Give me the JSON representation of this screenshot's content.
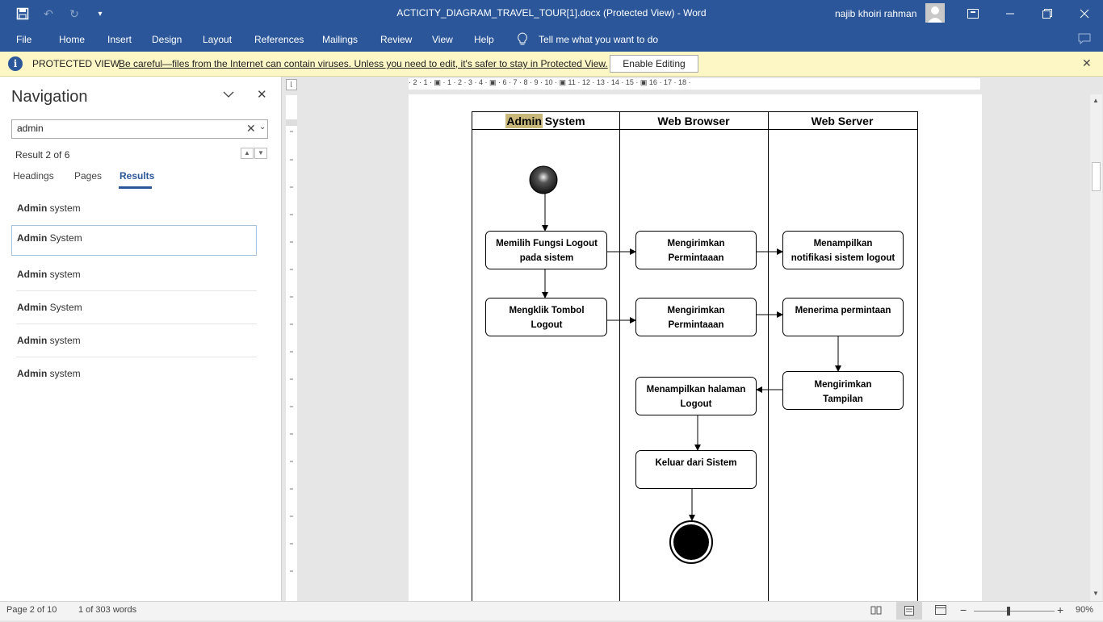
{
  "titlebar": {
    "doc_title": "ACTICITY_DIAGRAM_TRAVEL_TOUR[1].docx (Protected View)  -  Word",
    "user_name": "najib khoiri rahman"
  },
  "ribbon": {
    "tabs": [
      "File",
      "Home",
      "Insert",
      "Design",
      "Layout",
      "References",
      "Mailings",
      "Review",
      "View",
      "Help"
    ],
    "tell_me": "Tell me what you want to do"
  },
  "protected_view": {
    "title": "PROTECTED VIEW",
    "message": "Be careful—files from the Internet can contain viruses. Unless you need to edit, it's safer to stay in Protected View.",
    "enable_button": "Enable Editing"
  },
  "navigation": {
    "title": "Navigation",
    "search_value": "admin",
    "result_count": "Result 2 of 6",
    "tabs": {
      "headings": "Headings",
      "pages": "Pages",
      "results": "Results"
    },
    "results": [
      {
        "match": "Admin",
        "rest": " system"
      },
      {
        "match": "Admin",
        "rest": " System"
      },
      {
        "match": "Admin",
        "rest": " system"
      },
      {
        "match": "Admin",
        "rest": " System"
      },
      {
        "match": "Admin",
        "rest": " system"
      },
      {
        "match": "Admin",
        "rest": " system"
      }
    ]
  },
  "ruler": {
    "h_labels": "· 2 · 1 · ▣ · 1 · 2 · 3 · 4 · ▣ · 6 · 7 · 8 · 9 · 10 · ▣ 11 · 12 · 13 · 14 · 15 · ▣ 16 · 17 · 18 ·"
  },
  "diagram": {
    "lanes": {
      "admin_highlight": "Admin",
      "admin_rest": " System",
      "browser": "Web Browser",
      "server": "Web Server"
    },
    "activities": {
      "a1_l1": "Memilih Fungsi Logout",
      "a1_l2": "pada sistem",
      "b1_l1": "Mengirimkan",
      "b1_l2": "Permintaaan",
      "c1_l1": "Menampilkan",
      "c1_l2": "notifikasi sistem logout",
      "a2_l1": "Mengklik Tombol",
      "a2_l2": "Logout",
      "b2_l1": "Mengirimkan",
      "b2_l2": "Permintaaan",
      "c2_l1": "Menerima permintaan",
      "c3_l1": "Mengirimkan",
      "c3_l2": "Tampilan",
      "b3_l1": "Menampilkan halaman",
      "b3_l2": "Logout",
      "b4_l1": "Keluar dari Sistem"
    }
  },
  "statusbar": {
    "page": "Page 2 of 10",
    "words": "1 of 303 words",
    "zoom": "90%"
  },
  "colors": {
    "word_blue": "#2b579a",
    "protected_bg": "#fdf6c5",
    "highlight": "#c9b77a"
  }
}
